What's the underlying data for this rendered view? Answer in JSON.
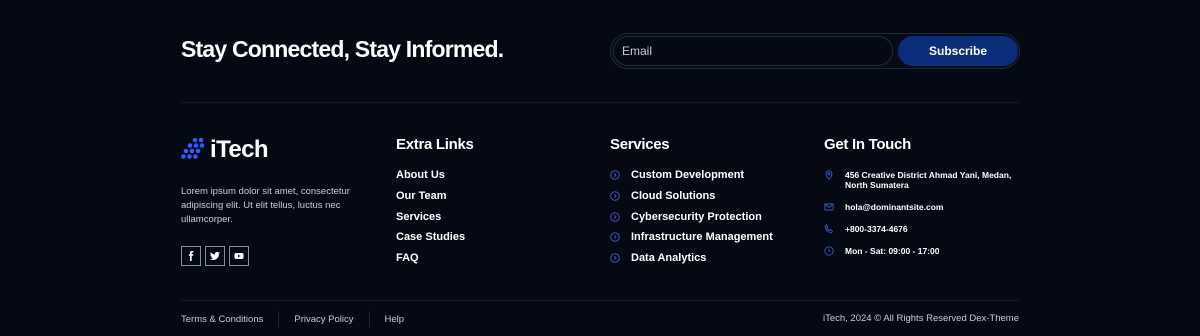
{
  "newsletter": {
    "title": "Stay Connected, Stay Informed.",
    "email_placeholder": "Email",
    "subscribe_label": "Subscribe"
  },
  "brand": {
    "name": "iTech",
    "description": "Lorem ipsum dolor sit amet, consectetur adipiscing elit. Ut elit tellus, luctus nec ullamcorper.",
    "socials": [
      "facebook-icon",
      "twitter-icon",
      "youtube-icon"
    ]
  },
  "extra_links": {
    "title": "Extra Links",
    "items": [
      "About Us",
      "Our Team",
      "Services",
      "Case Studies",
      "FAQ"
    ]
  },
  "services": {
    "title": "Services",
    "items": [
      "Custom Development",
      "Cloud Solutions",
      "Cybersecurity Protection",
      "Infrastructure Management",
      "Data Analytics"
    ]
  },
  "contact": {
    "title": "Get In Touch",
    "address": "456 Creative District Ahmad Yani, Medan, North Sumatera",
    "email": "hola@dominantsite.com",
    "phone": "+800-3374-4676",
    "hours": "Mon - Sat: 09:00 - 17:00"
  },
  "footer": {
    "links": [
      "Terms & Conditions",
      "Privacy Policy",
      "Help"
    ],
    "copyright": "iTech, 2024 © All Rights Reserved Dex-Theme"
  },
  "colors": {
    "background": "#050914",
    "accent": "#0c2e7a",
    "logo_blue": "#2f5bff"
  }
}
